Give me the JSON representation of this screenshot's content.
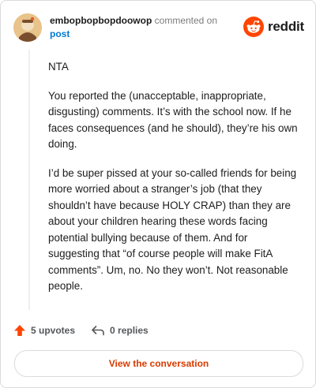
{
  "comment": {
    "username": "embopbopbopdoowop",
    "action_text": "commented on",
    "post_link": "post",
    "paragraphs": [
      "NTA",
      "You reported the (unacceptable, inappropriate, disgusting) comments. It’s with the school now. If he faces consequences (and he should), they’re his own doing.",
      "I’d be super pissed at your so-called friends for being more worried about a stranger’s job (that they shouldn’t have because HOLY CRAP) than they are about your children hearing these words facing potential bullying because of them. And for suggesting that “of course people will make FitA comments”. Um, no. No they won’t. Not reasonable people."
    ]
  },
  "brand": {
    "name": "reddit",
    "icon": "reddit-logo-icon",
    "color": "#ff4500"
  },
  "stats": {
    "upvotes": "5 upvotes",
    "replies": "0 replies",
    "upvote_icon": "upvote-arrow-icon",
    "reply_icon": "reply-arrow-icon",
    "upvote_color": "#ff4500"
  },
  "cta": {
    "label": "View the conversation",
    "color": "#d93a00"
  }
}
